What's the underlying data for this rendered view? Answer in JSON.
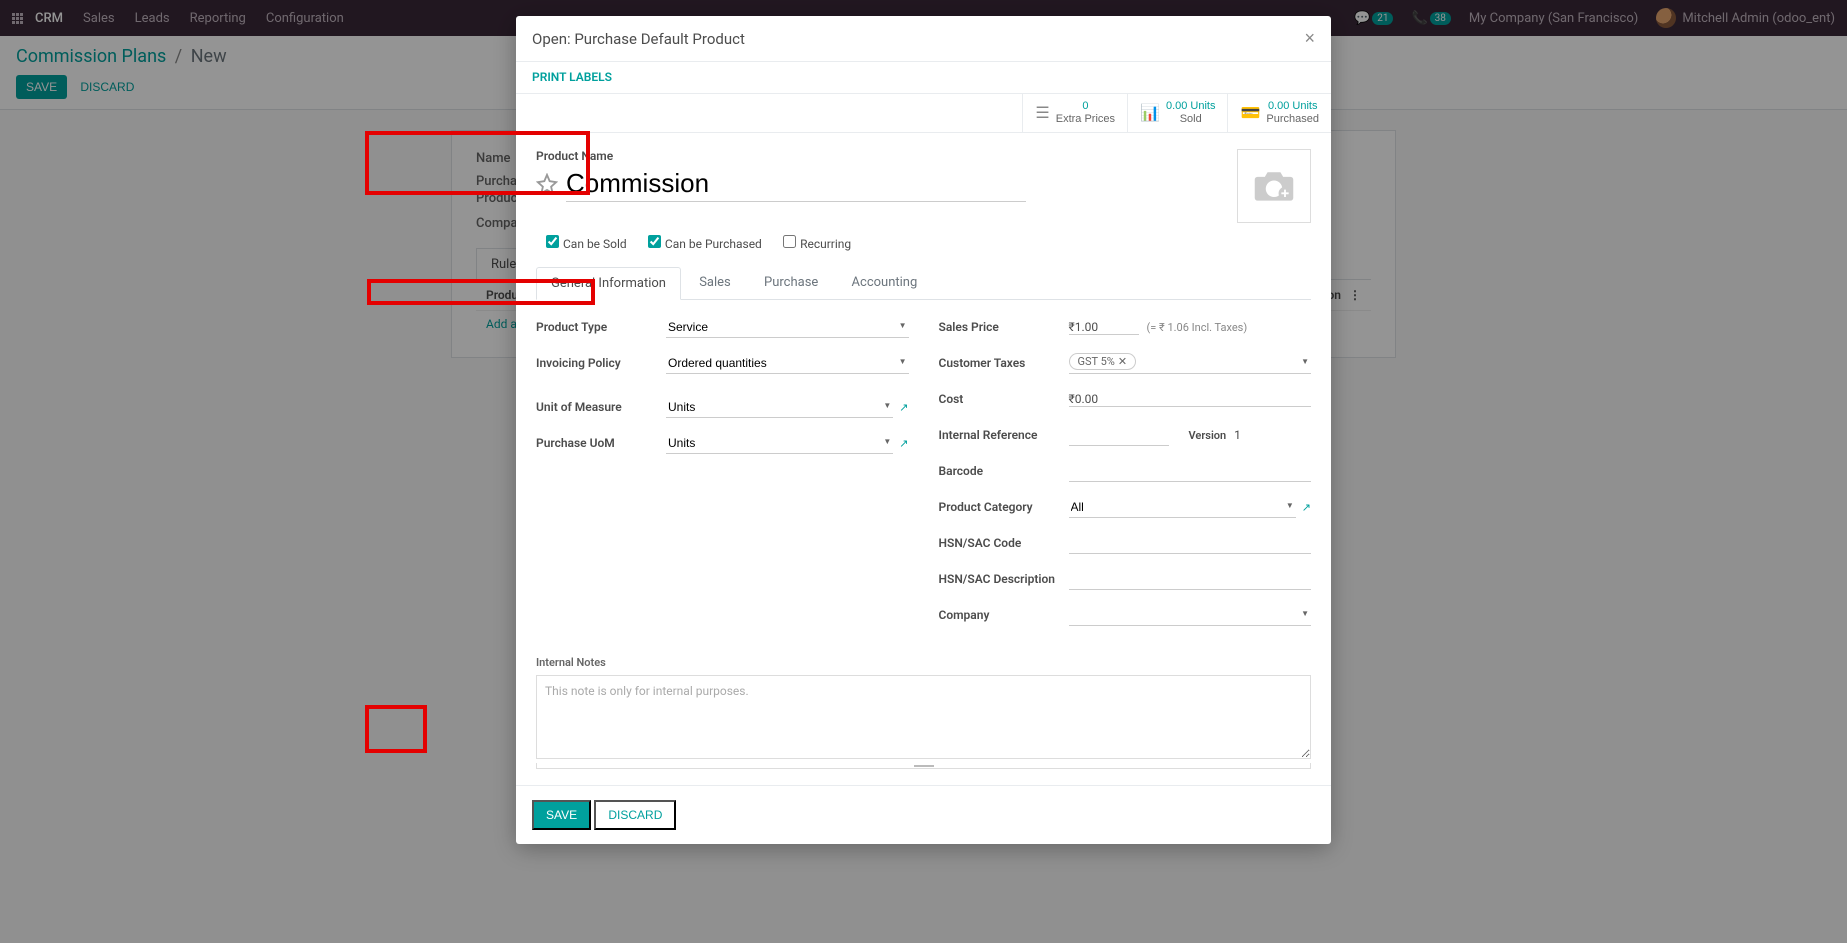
{
  "nav": {
    "brand": "CRM",
    "items": [
      "Sales",
      "Leads",
      "Reporting",
      "Configuration"
    ],
    "badge1": "21",
    "badge2": "38",
    "company": "My Company (San Francisco)",
    "user": "Mitchell Admin (odoo_ent)"
  },
  "breadcrumb": {
    "root": "Commission Plans",
    "current": "New"
  },
  "cp": {
    "save": "SAVE",
    "discard": "DISCARD"
  },
  "back_form": {
    "name_label": "Name",
    "purchase_label": "Purchase Default Product",
    "company_label": "Company",
    "tab_rules": "Rules",
    "col_product": "Product",
    "col_commission": "Commission",
    "add_line": "Add a line"
  },
  "modal": {
    "title": "Open: Purchase Default Product",
    "print_labels": "PRINT LABELS",
    "stats": {
      "extra_prices_v": "0",
      "extra_prices_l": "Extra Prices",
      "sold_v": "0.00 Units",
      "sold_l": "Sold",
      "purchased_v": "0.00 Units",
      "purchased_l": "Purchased"
    },
    "product_name_label": "Product Name",
    "product_name": "Commission",
    "checks": {
      "can_be_sold": "Can be Sold",
      "can_be_purchased": "Can be Purchased",
      "recurring": "Recurring"
    },
    "tabs": [
      "General Information",
      "Sales",
      "Purchase",
      "Accounting"
    ],
    "left_fields": {
      "product_type_l": "Product Type",
      "product_type_v": "Service",
      "invoicing_l": "Invoicing Policy",
      "invoicing_v": "Ordered quantities",
      "uom_l": "Unit of Measure",
      "uom_v": "Units",
      "purchase_uom_l": "Purchase UoM",
      "purchase_uom_v": "Units"
    },
    "right_fields": {
      "sales_price_l": "Sales Price",
      "sales_price_v": "₹1.00",
      "sales_price_hint": "(= ₹ 1.06 Incl. Taxes)",
      "cust_tax_l": "Customer Taxes",
      "cust_tax_tag": "GST 5%",
      "cost_l": "Cost",
      "cost_v": "₹0.00",
      "internal_ref_l": "Internal Reference",
      "version_l": "Version",
      "version_v": "1",
      "barcode_l": "Barcode",
      "category_l": "Product Category",
      "category_v": "All",
      "hsn_code_l": "HSN/SAC Code",
      "hsn_desc_l": "HSN/SAC Description",
      "company_l": "Company"
    },
    "notes_label": "Internal Notes",
    "notes_placeholder": "This note is only for internal purposes.",
    "footer": {
      "save": "SAVE",
      "discard": "DISCARD"
    }
  }
}
